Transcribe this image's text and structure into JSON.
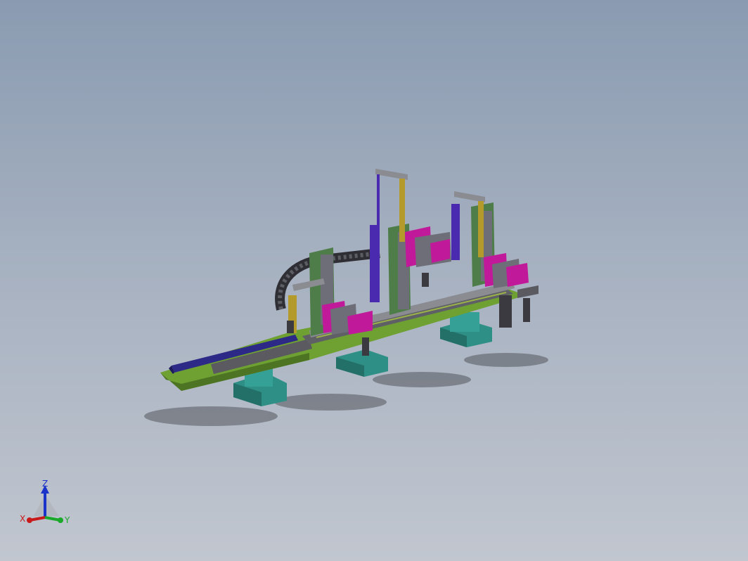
{
  "viewport": {
    "background_top": "#8a9bb1",
    "background_bottom": "#c1c6cf"
  },
  "triad": {
    "z_label": "Z",
    "x_label": "X",
    "y_label": "Y",
    "z_color": "#1a33c8",
    "x_color": "#c81a1a",
    "y_color": "#1aa82a"
  },
  "model": {
    "colors": {
      "base_plate": "#6ea032",
      "pedestal": "#2e8f86",
      "rail": "#2c2a86",
      "cylinder": "#4a2bb0",
      "rod_gold": "#b49a2a",
      "frame_green": "#4f7d4a",
      "block_magenta": "#c01a9a",
      "block_gray": "#6e6e78",
      "steel": "#5a5a60",
      "cable_chain": "#3a3a40"
    }
  }
}
